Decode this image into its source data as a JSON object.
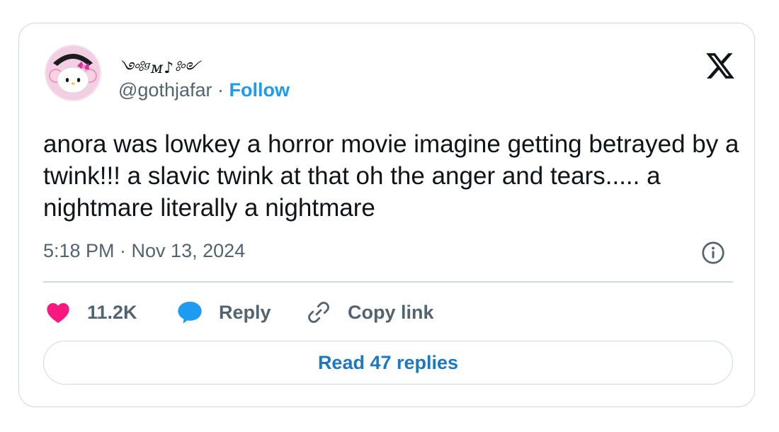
{
  "user": {
    "display_name": "༺ᵍᴍ♪༻",
    "handle": "@gothjafar",
    "separator": "·",
    "follow_label": "Follow",
    "avatar_icon": "hello-kitty-avatar"
  },
  "tweet": {
    "text": "anora was lowkey a horror movie imagine getting betrayed by a twink!!! a slavic twink at that oh the anger and tears..... a nightmare literally a nightmare",
    "timestamp": "5:18 PM · Nov 13, 2024"
  },
  "actions": {
    "like_count": "11.2K",
    "reply_label": "Reply",
    "copy_label": "Copy link"
  },
  "footer": {
    "read_replies_label": "Read 47 replies"
  },
  "colors": {
    "accent": "#1d9bf0",
    "like": "#f91880",
    "reply_icon": "#1d9bf0",
    "muted": "#536471",
    "border": "#cfd9de",
    "text": "#0f1419"
  },
  "icons": {
    "brand": "x-logo-icon",
    "info": "info-icon",
    "like": "heart-icon",
    "reply": "speech-bubble-icon",
    "copy": "link-icon"
  }
}
